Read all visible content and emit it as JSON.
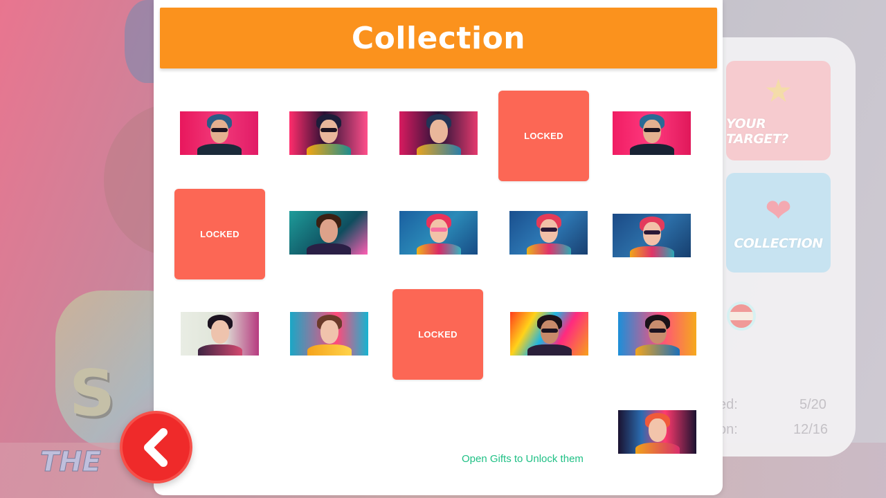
{
  "modal": {
    "title": "Collection",
    "hint": "Open Gifts to Unlock them",
    "locked_label": "LOCKED"
  },
  "side_panel": {
    "target_label": "YOUR TARGET?",
    "collection_label": "COLLECTION",
    "stats": [
      {
        "label": "ed:",
        "value": "5/20"
      },
      {
        "label": "on:",
        "value": "12/16"
      }
    ]
  },
  "background": {
    "logo_big": "S",
    "logo_small": "THE"
  },
  "icons": {
    "back": "chevron-left-icon",
    "target": "star-icon",
    "collection": "heart-icon",
    "language": "flag-icon"
  },
  "colors": {
    "header": "#fb921d",
    "locked_tile": "#fc6755",
    "hint_text": "#1fc085",
    "back_button": "#ef2a2a"
  }
}
